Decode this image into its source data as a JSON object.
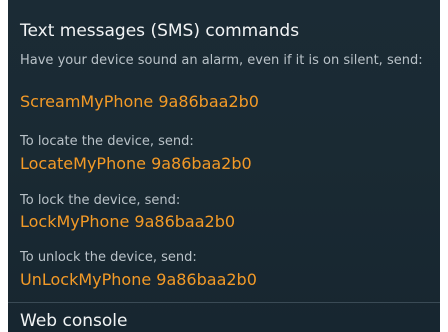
{
  "sms_section": {
    "title": "Text messages (SMS) commands",
    "commands": [
      {
        "description": "Have your device sound an alarm, even if it is on silent, send:",
        "command": "ScreamMyPhone 9a86baa2b0"
      },
      {
        "description": "To locate the device, send:",
        "command": "LocateMyPhone 9a86baa2b0"
      },
      {
        "description": "To lock the device, send:",
        "command": "LockMyPhone 9a86baa2b0"
      },
      {
        "description": "To unlock the device, send:",
        "command": "UnLockMyPhone 9a86baa2b0"
      }
    ]
  },
  "web_section": {
    "title": "Web console"
  },
  "colors": {
    "background": "#1a2a33",
    "title_text": "#f2f4f5",
    "description_text": "#b9c2c8",
    "command_text": "#f39a27"
  }
}
